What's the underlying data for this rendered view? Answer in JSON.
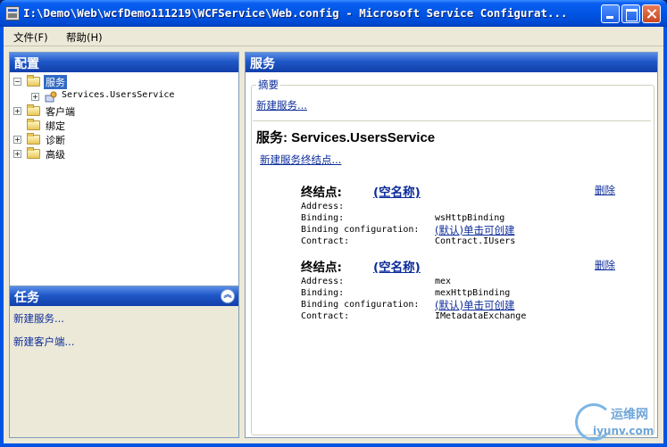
{
  "window": {
    "title": "I:\\Demo\\Web\\wcfDemo111219\\WCFService\\Web.config - Microsoft Service Configurat..."
  },
  "menubar": {
    "items": [
      {
        "label": "文件(F)"
      },
      {
        "label": "帮助(H)"
      }
    ]
  },
  "left_panel": {
    "title": "配置",
    "tree": [
      {
        "label": "服务",
        "expander": "−",
        "selected": true
      },
      {
        "label": "Services.UsersService",
        "expander": "+"
      },
      {
        "label": "客户端",
        "expander": "+"
      },
      {
        "label": "绑定",
        "expander": ""
      },
      {
        "label": "诊断",
        "expander": "+"
      },
      {
        "label": "高级",
        "expander": "+"
      }
    ]
  },
  "tasks_panel": {
    "title": "任务",
    "collapse_icon": "chevron-double-up-icon",
    "links": [
      {
        "label": "新建服务..."
      },
      {
        "label": "新建客户端..."
      }
    ]
  },
  "right_panel": {
    "title": "服务",
    "summary_legend": "摘要",
    "new_service_link": "新建服务...",
    "service_title": "服务: Services.UsersService",
    "new_endpoint_link": "新建服务终结点...",
    "endpoints": [
      {
        "label": "终结点:",
        "name": "(空名称)",
        "delete": "删除",
        "fields": [
          {
            "key": "Address:",
            "value": ""
          },
          {
            "key": "Binding:",
            "value": "wsHttpBinding"
          },
          {
            "key": "Binding configuration:",
            "value": "(默认)单击可创建",
            "is_link": true
          },
          {
            "key": "Contract:",
            "value": "Contract.IUsers"
          }
        ]
      },
      {
        "label": "终结点:",
        "name": "(空名称)",
        "delete": "删除",
        "fields": [
          {
            "key": "Address:",
            "value": "mex"
          },
          {
            "key": "Binding:",
            "value": "mexHttpBinding"
          },
          {
            "key": "Binding configuration:",
            "value": "(默认)单击可创建",
            "is_link": true
          },
          {
            "key": "Contract:",
            "value": "IMetadataExchange"
          }
        ]
      }
    ]
  },
  "watermark": {
    "text_cn": "运维网",
    "text_url": "iyunv.com"
  },
  "colors": {
    "titlebar": "#0055e5",
    "panel_header": "#1f57c7",
    "link": "#0c2c9a",
    "selection": "#316ac5"
  }
}
